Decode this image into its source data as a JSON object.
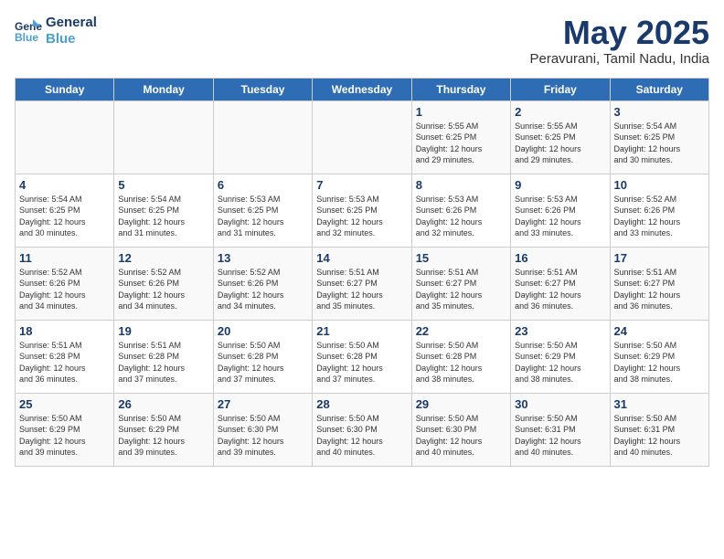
{
  "logo": {
    "line1": "General",
    "line2": "Blue"
  },
  "title": "May 2025",
  "subtitle": "Peravurani, Tamil Nadu, India",
  "weekdays": [
    "Sunday",
    "Monday",
    "Tuesday",
    "Wednesday",
    "Thursday",
    "Friday",
    "Saturday"
  ],
  "weeks": [
    [
      {
        "day": "",
        "info": ""
      },
      {
        "day": "",
        "info": ""
      },
      {
        "day": "",
        "info": ""
      },
      {
        "day": "",
        "info": ""
      },
      {
        "day": "1",
        "info": "Sunrise: 5:55 AM\nSunset: 6:25 PM\nDaylight: 12 hours\nand 29 minutes."
      },
      {
        "day": "2",
        "info": "Sunrise: 5:55 AM\nSunset: 6:25 PM\nDaylight: 12 hours\nand 29 minutes."
      },
      {
        "day": "3",
        "info": "Sunrise: 5:54 AM\nSunset: 6:25 PM\nDaylight: 12 hours\nand 30 minutes."
      }
    ],
    [
      {
        "day": "4",
        "info": "Sunrise: 5:54 AM\nSunset: 6:25 PM\nDaylight: 12 hours\nand 30 minutes."
      },
      {
        "day": "5",
        "info": "Sunrise: 5:54 AM\nSunset: 6:25 PM\nDaylight: 12 hours\nand 31 minutes."
      },
      {
        "day": "6",
        "info": "Sunrise: 5:53 AM\nSunset: 6:25 PM\nDaylight: 12 hours\nand 31 minutes."
      },
      {
        "day": "7",
        "info": "Sunrise: 5:53 AM\nSunset: 6:25 PM\nDaylight: 12 hours\nand 32 minutes."
      },
      {
        "day": "8",
        "info": "Sunrise: 5:53 AM\nSunset: 6:26 PM\nDaylight: 12 hours\nand 32 minutes."
      },
      {
        "day": "9",
        "info": "Sunrise: 5:53 AM\nSunset: 6:26 PM\nDaylight: 12 hours\nand 33 minutes."
      },
      {
        "day": "10",
        "info": "Sunrise: 5:52 AM\nSunset: 6:26 PM\nDaylight: 12 hours\nand 33 minutes."
      }
    ],
    [
      {
        "day": "11",
        "info": "Sunrise: 5:52 AM\nSunset: 6:26 PM\nDaylight: 12 hours\nand 34 minutes."
      },
      {
        "day": "12",
        "info": "Sunrise: 5:52 AM\nSunset: 6:26 PM\nDaylight: 12 hours\nand 34 minutes."
      },
      {
        "day": "13",
        "info": "Sunrise: 5:52 AM\nSunset: 6:26 PM\nDaylight: 12 hours\nand 34 minutes."
      },
      {
        "day": "14",
        "info": "Sunrise: 5:51 AM\nSunset: 6:27 PM\nDaylight: 12 hours\nand 35 minutes."
      },
      {
        "day": "15",
        "info": "Sunrise: 5:51 AM\nSunset: 6:27 PM\nDaylight: 12 hours\nand 35 minutes."
      },
      {
        "day": "16",
        "info": "Sunrise: 5:51 AM\nSunset: 6:27 PM\nDaylight: 12 hours\nand 36 minutes."
      },
      {
        "day": "17",
        "info": "Sunrise: 5:51 AM\nSunset: 6:27 PM\nDaylight: 12 hours\nand 36 minutes."
      }
    ],
    [
      {
        "day": "18",
        "info": "Sunrise: 5:51 AM\nSunset: 6:28 PM\nDaylight: 12 hours\nand 36 minutes."
      },
      {
        "day": "19",
        "info": "Sunrise: 5:51 AM\nSunset: 6:28 PM\nDaylight: 12 hours\nand 37 minutes."
      },
      {
        "day": "20",
        "info": "Sunrise: 5:50 AM\nSunset: 6:28 PM\nDaylight: 12 hours\nand 37 minutes."
      },
      {
        "day": "21",
        "info": "Sunrise: 5:50 AM\nSunset: 6:28 PM\nDaylight: 12 hours\nand 37 minutes."
      },
      {
        "day": "22",
        "info": "Sunrise: 5:50 AM\nSunset: 6:28 PM\nDaylight: 12 hours\nand 38 minutes."
      },
      {
        "day": "23",
        "info": "Sunrise: 5:50 AM\nSunset: 6:29 PM\nDaylight: 12 hours\nand 38 minutes."
      },
      {
        "day": "24",
        "info": "Sunrise: 5:50 AM\nSunset: 6:29 PM\nDaylight: 12 hours\nand 38 minutes."
      }
    ],
    [
      {
        "day": "25",
        "info": "Sunrise: 5:50 AM\nSunset: 6:29 PM\nDaylight: 12 hours\nand 39 minutes."
      },
      {
        "day": "26",
        "info": "Sunrise: 5:50 AM\nSunset: 6:29 PM\nDaylight: 12 hours\nand 39 minutes."
      },
      {
        "day": "27",
        "info": "Sunrise: 5:50 AM\nSunset: 6:30 PM\nDaylight: 12 hours\nand 39 minutes."
      },
      {
        "day": "28",
        "info": "Sunrise: 5:50 AM\nSunset: 6:30 PM\nDaylight: 12 hours\nand 40 minutes."
      },
      {
        "day": "29",
        "info": "Sunrise: 5:50 AM\nSunset: 6:30 PM\nDaylight: 12 hours\nand 40 minutes."
      },
      {
        "day": "30",
        "info": "Sunrise: 5:50 AM\nSunset: 6:31 PM\nDaylight: 12 hours\nand 40 minutes."
      },
      {
        "day": "31",
        "info": "Sunrise: 5:50 AM\nSunset: 6:31 PM\nDaylight: 12 hours\nand 40 minutes."
      }
    ]
  ]
}
